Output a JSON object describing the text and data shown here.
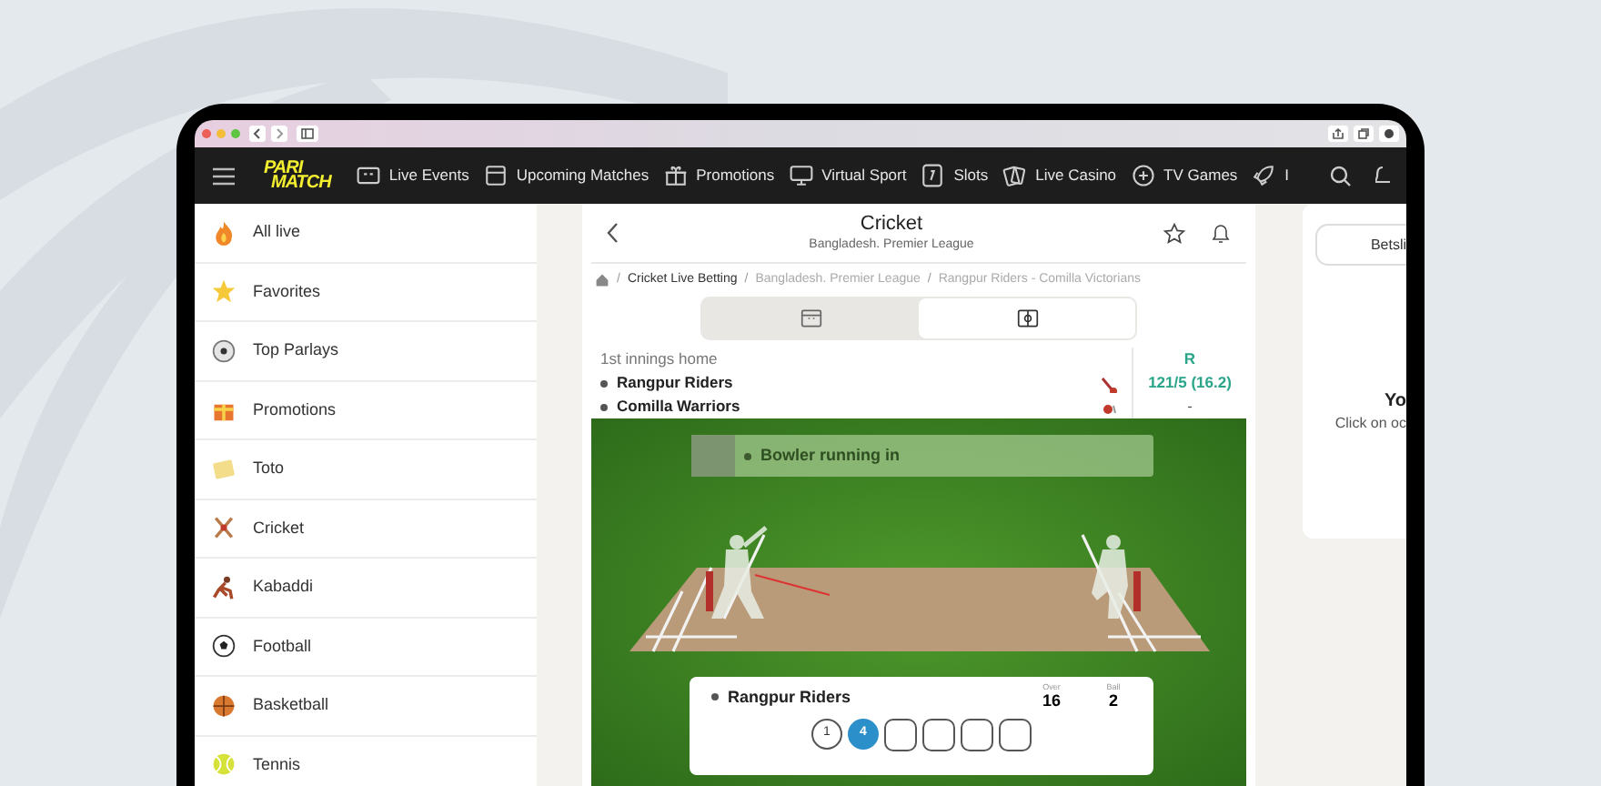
{
  "nav": {
    "logo": [
      "PARI",
      "MATCH"
    ],
    "items": [
      {
        "label": "Live Events",
        "kind": "score"
      },
      {
        "label": "Upcoming Matches",
        "kind": "calendar"
      },
      {
        "label": "Promotions",
        "kind": "gift"
      },
      {
        "label": "Virtual Sport",
        "kind": "screen"
      },
      {
        "label": "Slots",
        "kind": "slot"
      },
      {
        "label": "Live Casino",
        "kind": "cards"
      },
      {
        "label": "TV Games",
        "kind": "plus"
      },
      {
        "label": "I",
        "kind": "rocket"
      }
    ]
  },
  "sidebar": {
    "items": [
      {
        "label": "All live"
      },
      {
        "label": "Favorites"
      },
      {
        "label": "Top Parlays"
      },
      {
        "label": "Promotions"
      },
      {
        "label": "Toto"
      },
      {
        "label": "Cricket"
      },
      {
        "label": "Kabaddi"
      },
      {
        "label": "Football"
      },
      {
        "label": "Basketball"
      },
      {
        "label": "Tennis"
      }
    ]
  },
  "match": {
    "title": "Cricket",
    "subtitle": "Bangladesh. Premier League",
    "breadcrumb": [
      {
        "separator": "/",
        "label": "Cricket Live Betting",
        "current": false
      },
      {
        "separator": "/",
        "label": "Bangladesh. Premier League",
        "current": true
      },
      {
        "separator": "/",
        "label": "Rangpur Riders - Comilla Victorians",
        "current": true
      }
    ],
    "view_tabs": [
      {
        "kind": "scoreboard",
        "selected": false
      },
      {
        "kind": "field",
        "selected": true
      }
    ],
    "score": {
      "innings": "1st innings home",
      "column": "R",
      "teams": [
        {
          "name": "Rangpur Riders",
          "kind": "batting",
          "runs": "121/5 (16.2)"
        },
        {
          "name": "Comilla Warriors",
          "kind": "bowling",
          "runs": "-"
        }
      ]
    },
    "field": {
      "event": "Bowler running in",
      "team": "Rangpur Riders",
      "over_label": "Over",
      "over": "16",
      "ball_label": "Ball",
      "ball": "2",
      "balls": [
        {
          "kind": "run",
          "label": "1"
        },
        {
          "kind": "boundary",
          "label": "4"
        },
        {
          "kind": "empty"
        },
        {
          "kind": "empty"
        },
        {
          "kind": "empty"
        },
        {
          "kind": "empty"
        }
      ]
    }
  },
  "betslip": {
    "tab": "Betsli",
    "heading": "Yo",
    "hint": "Click on oc"
  }
}
